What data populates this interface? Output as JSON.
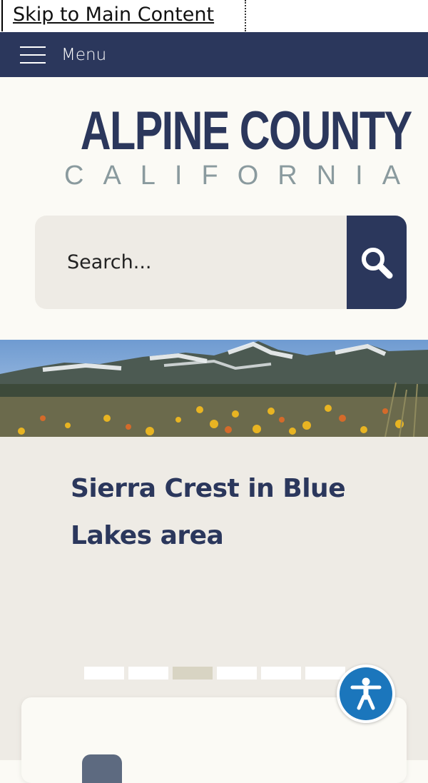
{
  "skip_link": {
    "label": "Skip to Main Content"
  },
  "nav": {
    "menu_label": "Menu"
  },
  "logo": {
    "main": "ALPINE COUNTY",
    "sub": "CALIFORNIA"
  },
  "search": {
    "placeholder": "Search..."
  },
  "slideshow": {
    "caption": "Sierra Crest in Blue Lakes area",
    "slide_count": 6,
    "active_index": 2
  },
  "icons": {
    "menu": "hamburger-icon",
    "search": "magnifier-icon",
    "accessibility": "accessibility-person-icon"
  },
  "colors": {
    "brand_navy": "#2b375c",
    "panel_beige": "#eeebe5",
    "accessibility_blue": "#1b76bc",
    "logo_gray": "#8a9a9e"
  }
}
